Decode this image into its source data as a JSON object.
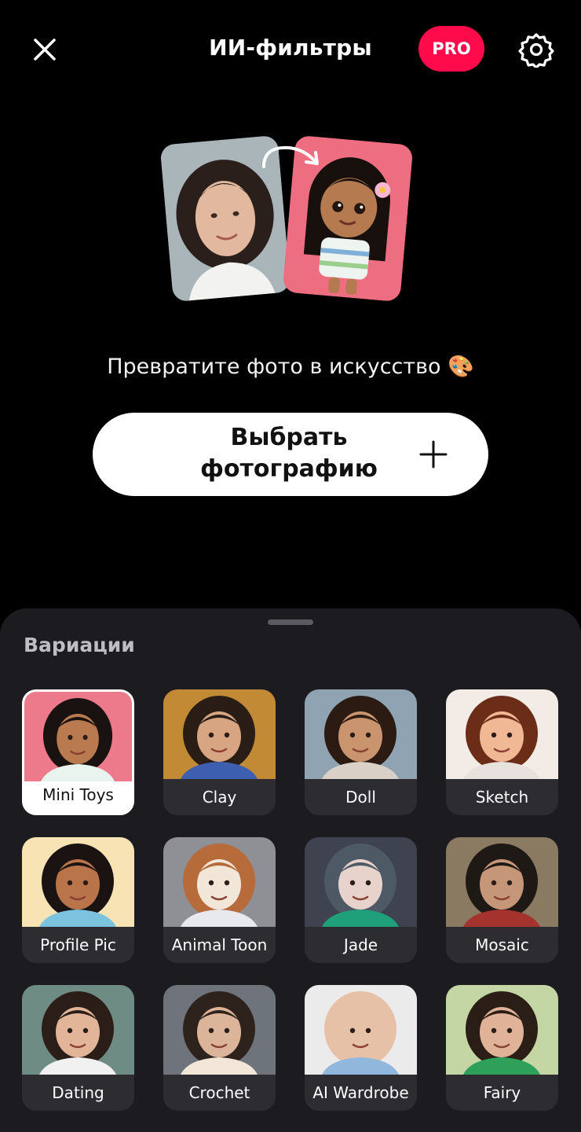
{
  "header": {
    "title": "ИИ-фильтры",
    "pro_label": "PRO"
  },
  "hero": {
    "tagline": "Превратите фото в искусство 🎨"
  },
  "choose_button": {
    "label": "Выбрать фотографию"
  },
  "sheet": {
    "section_title": "Вариации",
    "items": [
      {
        "label": "Mini Toys",
        "selected": true,
        "bg": "#ec7a8a",
        "skin": "#b87a4e",
        "hair": "#1a1210",
        "shirt": "#e9f4ef"
      },
      {
        "label": "Clay",
        "selected": false,
        "bg": "#c28a34",
        "skin": "#d7a582",
        "hair": "#2a1d16",
        "shirt": "#3e5fb0"
      },
      {
        "label": "Doll",
        "selected": false,
        "bg": "#8fa3b3",
        "skin": "#c9946e",
        "hair": "#2b1b12",
        "shirt": "#d9d1c8"
      },
      {
        "label": "Sketch",
        "selected": false,
        "bg": "#f3ece6",
        "skin": "#f0b894",
        "hair": "#6b2d17",
        "shirt": "#e8e2df"
      },
      {
        "label": "Profile Pic",
        "selected": false,
        "bg": "#f7e3b4",
        "skin": "#b9744a",
        "hair": "#1a1312",
        "shirt": "#7cc3e0"
      },
      {
        "label": "Animal Toon",
        "selected": false,
        "bg": "#8f8f96",
        "skin": "#f2e6d8",
        "hair": "#b76a3a",
        "shirt": "#e7e9ee"
      },
      {
        "label": "Jade",
        "selected": false,
        "bg": "#3f4350",
        "skin": "#e7d3cc",
        "hair": "#4d5a66",
        "shirt": "#1fa07a"
      },
      {
        "label": "Mosaic",
        "selected": false,
        "bg": "#8b7a62",
        "skin": "#c59677",
        "hair": "#1f1915",
        "shirt": "#a3332c"
      },
      {
        "label": "Dating",
        "selected": false,
        "bg": "#6e8c84",
        "skin": "#e3b598",
        "hair": "#2b1e18",
        "shirt": "#f1f1f1"
      },
      {
        "label": "Crochet",
        "selected": false,
        "bg": "#6f737c",
        "skin": "#dcb49a",
        "hair": "#2d221c",
        "shirt": "#f1e6d8"
      },
      {
        "label": "AI Wardrobe",
        "selected": false,
        "bg": "#ecebec",
        "skin": "#e7c1a7",
        "hair": "#e7c1a7",
        "shirt": "#8fb8dc"
      },
      {
        "label": "Fairy",
        "selected": false,
        "bg": "#c5d6a5",
        "skin": "#e0b398",
        "hair": "#2a1e16",
        "shirt": "#2fa05a"
      }
    ]
  }
}
